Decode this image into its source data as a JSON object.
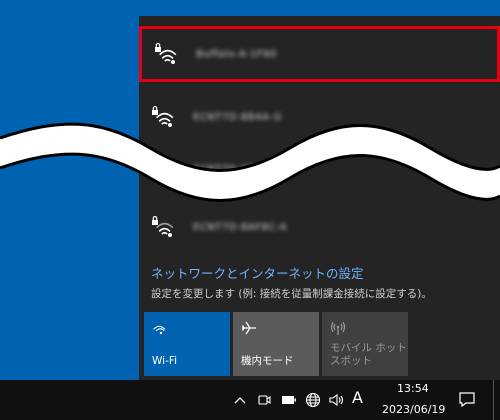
{
  "networks": [
    {
      "name": "Buffalo-A-1F80",
      "secured": true,
      "selected": true
    },
    {
      "name": "ECNT7D-8B4A-G",
      "secured": true,
      "selected": false
    },
    {
      "name": "ECNT7D-8B4A-A",
      "secured": true,
      "selected": false
    },
    {
      "name": "ECNT7D-8AF8C-A",
      "secured": true,
      "selected": false
    }
  ],
  "settings": {
    "link": "ネットワークとインターネットの設定",
    "desc": "設定を変更します (例: 接続を従量制課金接続に設定する)。"
  },
  "tiles": {
    "wifi": "Wi-Fi",
    "airplane": "機内モード",
    "hotspot": "モバイル ホットスポット"
  },
  "taskbar": {
    "ime": "A",
    "time": "13:54",
    "date": "2023/06/19"
  },
  "colors": {
    "desktop": "#0063b1",
    "flyout": "#242424",
    "selected_border": "#e60012",
    "link": "#6fb4ff",
    "wifi_tile": "#0063b1"
  },
  "icons": [
    "wifi-secured-icon",
    "airplane-icon",
    "hotspot-icon",
    "chevron-up-icon",
    "meet-now-icon",
    "battery-icon",
    "globe-icon",
    "volume-icon",
    "notification-icon"
  ]
}
